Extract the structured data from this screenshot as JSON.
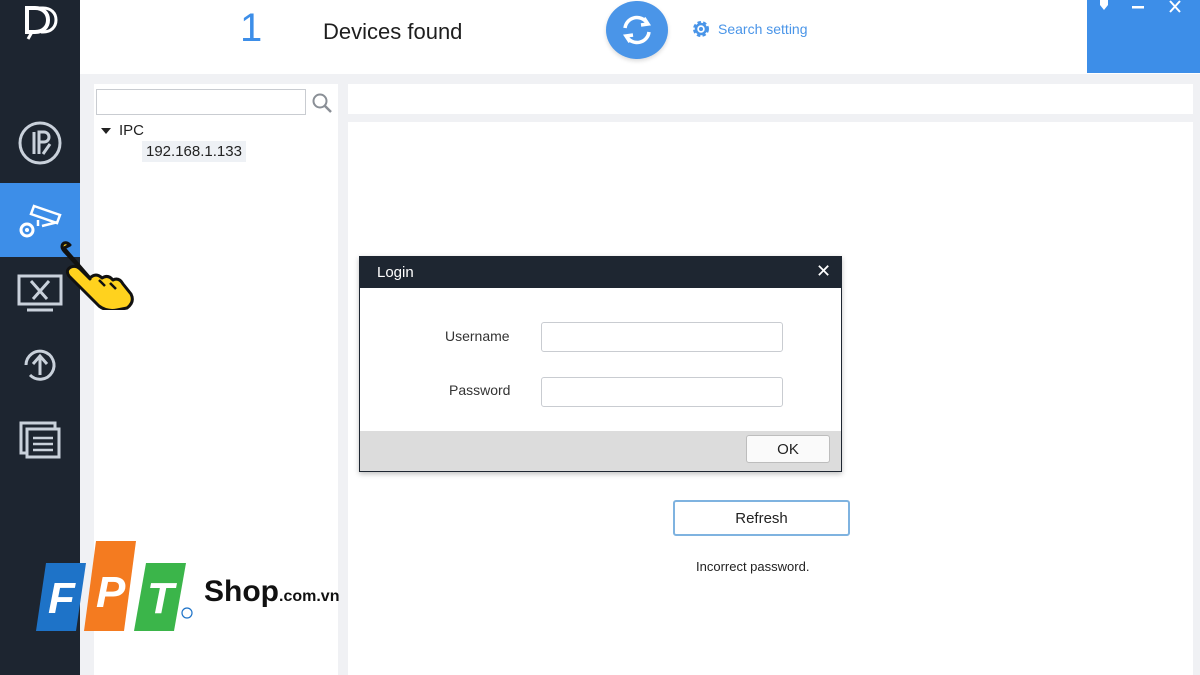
{
  "header": {
    "device_count": "1",
    "devices_found_label": "Devices found",
    "search_setting_label": "Search setting"
  },
  "tree": {
    "search_placeholder": "",
    "root_label": "IPC",
    "child_label": "192.168.1.133"
  },
  "login_dialog": {
    "title": "Login",
    "close_glyph": "✕",
    "username_label": "Username",
    "username_value": "",
    "password_label": "Password",
    "password_value": "",
    "ok_label": "OK"
  },
  "main": {
    "refresh_label": "Refresh",
    "status_message": "Incorrect password."
  },
  "watermark": {
    "brand_letters": "FPT",
    "shop_label": "Shop",
    "domain_suffix": ".com.vn"
  },
  "colors": {
    "accent": "#3d8ee8",
    "rail": "#1d2530",
    "dialog_title": "#1e2631",
    "fpt_blue": "#1e73c8",
    "fpt_orange": "#f47b20",
    "fpt_green": "#3bb54a"
  },
  "icons": {
    "rail": [
      "ip-config-icon",
      "device-config-icon",
      "system-settings-icon",
      "upgrade-icon",
      "documents-icon"
    ],
    "header": [
      "refresh-icon",
      "gear-icon"
    ]
  }
}
